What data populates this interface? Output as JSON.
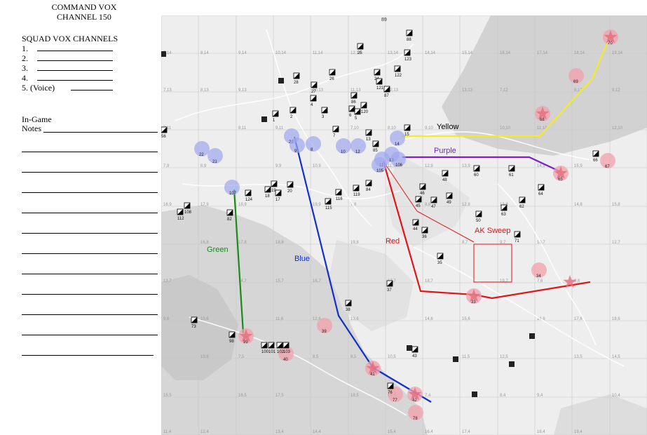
{
  "header": {
    "title_line1": "COMMAND VOX",
    "title_line2": "CHANNEL 150"
  },
  "squad_vox": {
    "heading": "SQUAD VOX CHANNELS",
    "items": [
      "1.",
      "2.",
      "3.",
      "4.",
      "5. (Voice)"
    ]
  },
  "notes": {
    "line1": "In-Game",
    "line2": "Notes"
  },
  "map": {
    "top_marker": "89",
    "routes": [
      {
        "name": "Yellow",
        "color": "#f2ea2a"
      },
      {
        "name": "Purple",
        "color": "#7b1fd6"
      },
      {
        "name": "Red",
        "color": "#e01515"
      },
      {
        "name": "Blue",
        "color": "#1030c8"
      },
      {
        "name": "Green",
        "color": "#1a8a1a"
      }
    ],
    "ak_sweep_label": "AK Sweep",
    "objectives_red": [
      "70",
      "69",
      "68",
      "65",
      "67",
      "39",
      "40",
      "41",
      "42",
      "77",
      "78",
      "99",
      "33",
      "34"
    ],
    "objectives_blue": [
      "22",
      "21",
      "23",
      "9",
      "8",
      "10",
      "12",
      "14",
      "13",
      "11",
      "105",
      "106",
      "107"
    ],
    "unit_numbers": [
      "1",
      "2",
      "3",
      "4",
      "5",
      "6",
      "7",
      "13",
      "15",
      "17",
      "18",
      "19",
      "20",
      "24",
      "25",
      "26",
      "27",
      "28",
      "35",
      "36",
      "37",
      "38",
      "43",
      "44",
      "45",
      "46",
      "47",
      "48",
      "49",
      "50",
      "56",
      "60",
      "61",
      "62",
      "63",
      "64",
      "66",
      "71",
      "73",
      "76",
      "82",
      "84",
      "85",
      "86",
      "87",
      "88",
      "98",
      "100",
      "101",
      "102",
      "103",
      "108",
      "112",
      "115",
      "116",
      "119",
      "120",
      "121",
      "122",
      "123",
      "124"
    ],
    "col_labels": [
      "7,14",
      "8,14",
      "9,14",
      "10,14",
      "11,14",
      "12,14",
      "13,14",
      "14,14",
      "15,14",
      "16,14",
      "17,14",
      "18,14",
      "19,14"
    ],
    "row_labels": [
      "7,13",
      "8,13",
      "9,13",
      "10,13",
      "11,13",
      "12,13",
      "13,13",
      "7,12",
      "8,12",
      "9,12",
      "7,11",
      "8,11",
      "9,11",
      "7,10",
      "8,10",
      "9,10",
      "10,10",
      "11,10",
      "12,10",
      "7,9",
      "8,9",
      "9,9",
      "10,9",
      "11,9",
      "12,9",
      "13,9",
      "14,9",
      "15,9",
      "16,9",
      "17,9",
      "18,9",
      "19,9",
      "7,8",
      "8,8",
      "12,8",
      "13,8",
      "14,8",
      "15,8",
      "16,8",
      "17,8",
      "18,8",
      "19,8",
      "7,7",
      "8,7",
      "9,7",
      "10,7",
      "12,7",
      "13,7",
      "14,7",
      "15,7",
      "16,7",
      "17,7",
      "18,7",
      "19,7",
      "7,6",
      "8,6",
      "9,6",
      "10,6",
      "11,6",
      "12,6",
      "13,6",
      "14,6",
      "15,6",
      "16,6",
      "17,6",
      "18,6",
      "19,6",
      "7,5",
      "8,5",
      "9,5",
      "10,5",
      "11,5",
      "12,5",
      "13,5",
      "14,5",
      "15,5",
      "16,5",
      "17,5",
      "18,5",
      "19,5",
      "7,4",
      "8,4",
      "9,4",
      "10,4",
      "11,4",
      "12,4",
      "13,4",
      "14,4",
      "15,4",
      "16,4",
      "17,4",
      "18,4",
      "19,4"
    ]
  }
}
